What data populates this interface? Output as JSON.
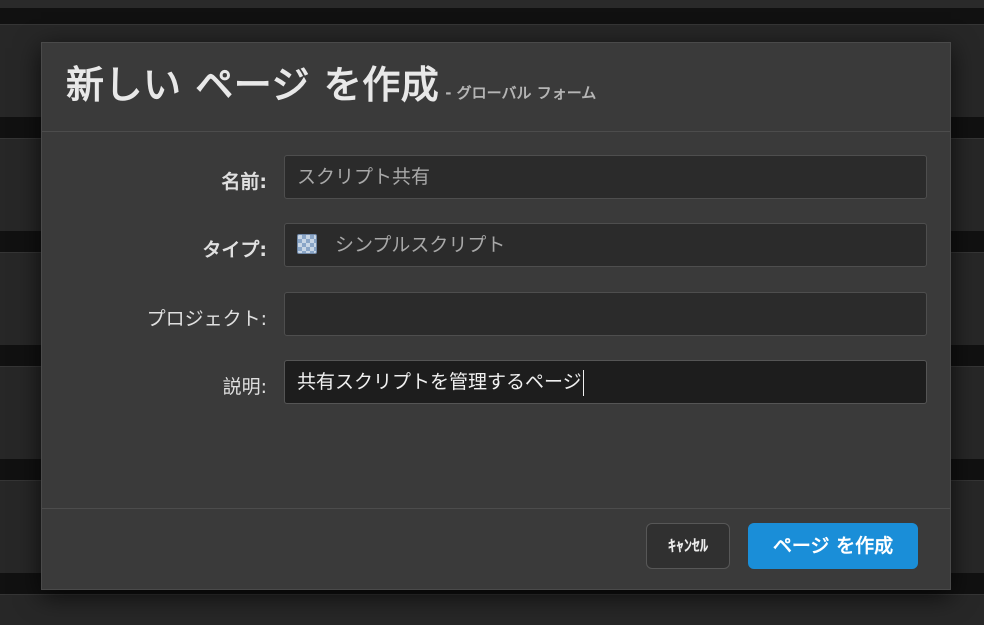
{
  "dialog": {
    "title": "新しい ページ を作成",
    "subtitle": "- グローバル フォーム"
  },
  "form": {
    "name": {
      "label": "名前:",
      "placeholder": "スクリプト共有"
    },
    "type": {
      "label": "タイプ:",
      "value": "シンプルスクリプト",
      "icon": "script-icon"
    },
    "project": {
      "label": "プロジェクト:",
      "value": ""
    },
    "description": {
      "label": "説明:",
      "value": "共有スクリプトを管理するページ"
    }
  },
  "footer": {
    "cancel_label": "ｷｬﾝｾﾙ",
    "create_label": "ページ を作成"
  },
  "colors": {
    "primary": "#1a8ed8",
    "dialog_bg": "#3a3a3a",
    "field_bg": "#2b2b2b"
  }
}
